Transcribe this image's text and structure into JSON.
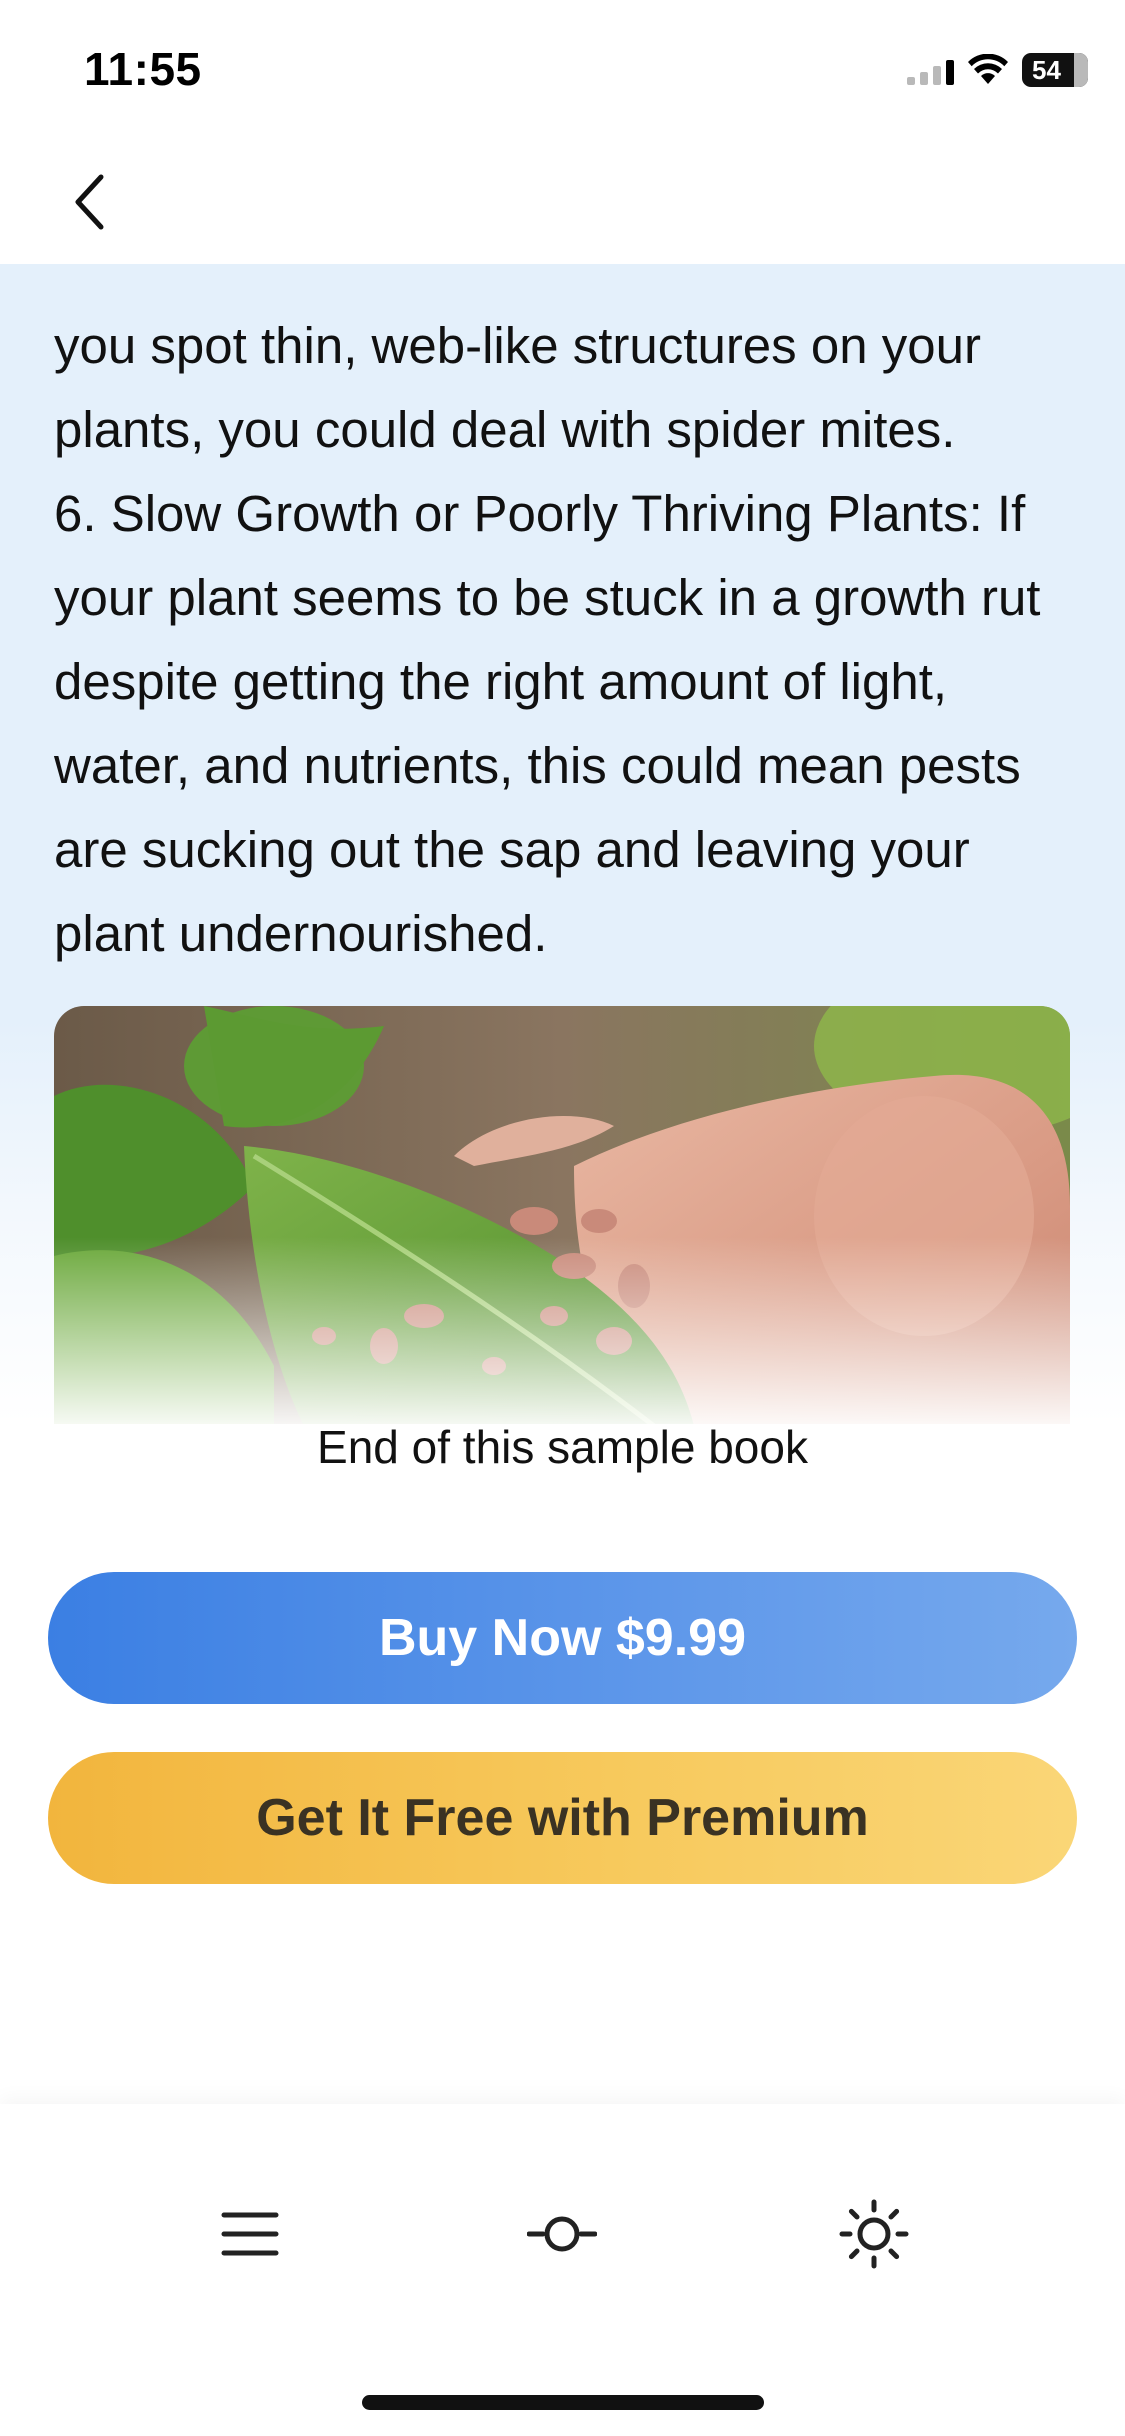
{
  "status_bar": {
    "time": "11:55",
    "battery": "54"
  },
  "nav": {
    "back_icon": "chevron-left-icon"
  },
  "reader": {
    "paragraphs": [
      "you spot thin, web-like structures on your plants, you could deal with spider mites.",
      "6. Slow Growth or Poorly Thriving Plants: If your plant seems to be stuck in a growth rut despite getting the right amount of light, water, and nutrients, this could mean pests are sucking out the sap and leaving your plant undernourished."
    ],
    "end_label": "End of this sample book"
  },
  "actions": {
    "buy_label": "Buy Now $9.99",
    "premium_label": "Get It Free with Premium",
    "buy_color": "#3b7fe3",
    "premium_color": "#f2b53d"
  },
  "toolbar": {
    "icons": [
      "menu-icon",
      "slider-icon",
      "brightness-icon"
    ]
  }
}
